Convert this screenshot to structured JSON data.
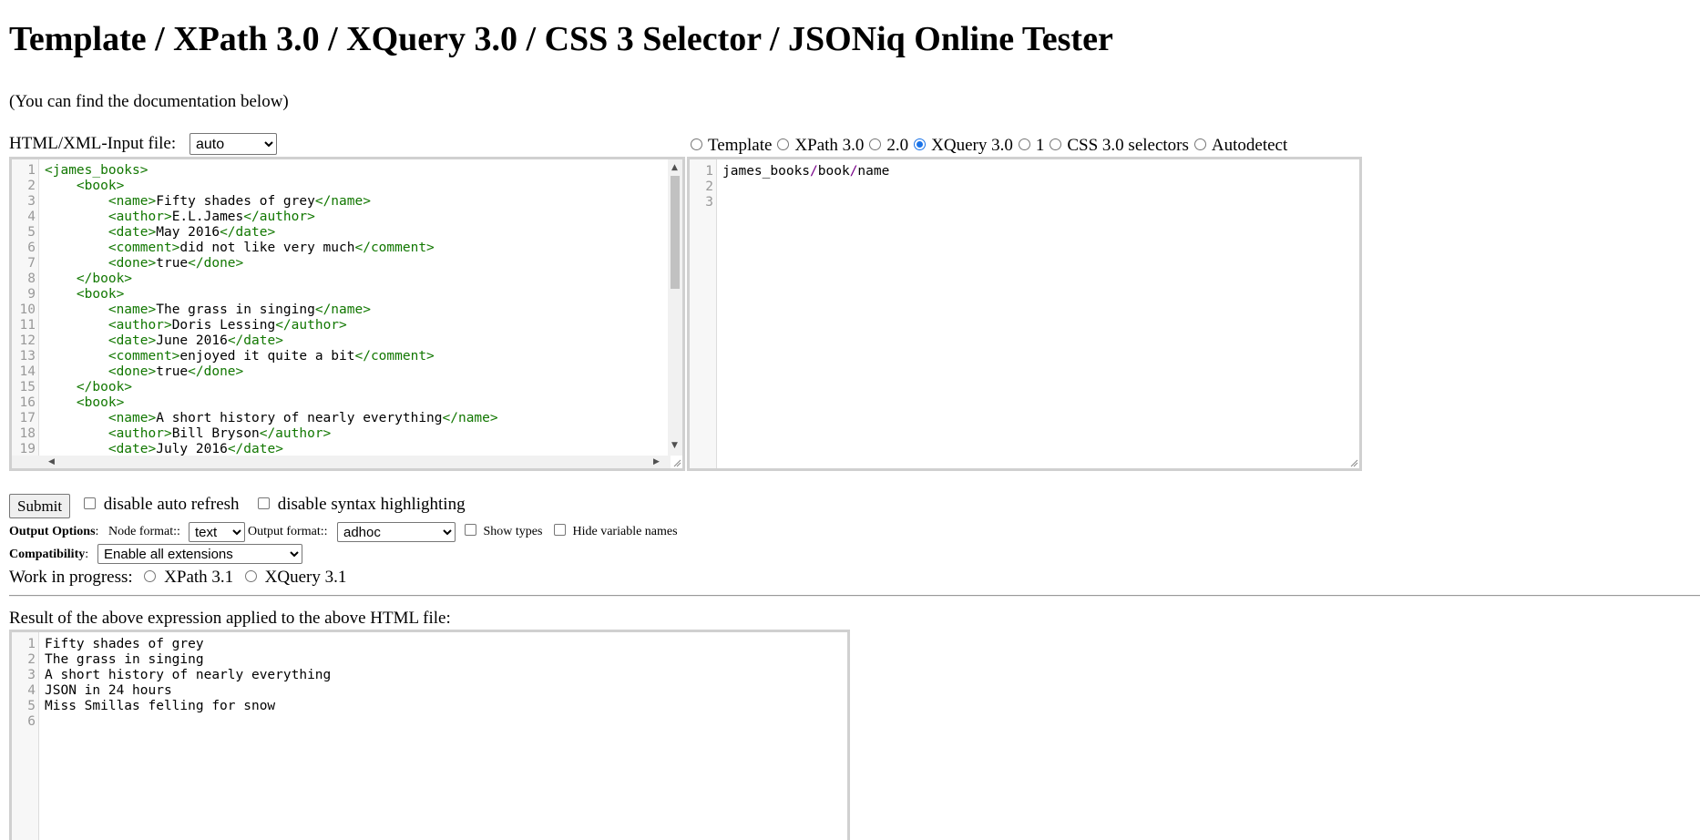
{
  "page": {
    "title": "Template / XPath 3.0 / XQuery 3.0 / CSS 3 Selector / JSONiq Online Tester",
    "doc_note": "(You can find the documentation below)"
  },
  "input": {
    "label": "HTML/XML-Input file:",
    "format_selected": "auto",
    "lines": [
      [
        [
          "t",
          "<james_books>"
        ]
      ],
      [
        [
          "p",
          "    "
        ],
        [
          "t",
          "<book>"
        ]
      ],
      [
        [
          "p",
          "        "
        ],
        [
          "t",
          "<name>"
        ],
        [
          "p",
          "Fifty shades of grey"
        ],
        [
          "t",
          "</name>"
        ]
      ],
      [
        [
          "p",
          "        "
        ],
        [
          "t",
          "<author>"
        ],
        [
          "p",
          "E.L.James"
        ],
        [
          "t",
          "</author>"
        ]
      ],
      [
        [
          "p",
          "        "
        ],
        [
          "t",
          "<date>"
        ],
        [
          "p",
          "May 2016"
        ],
        [
          "t",
          "</date>"
        ]
      ],
      [
        [
          "p",
          "        "
        ],
        [
          "t",
          "<comment>"
        ],
        [
          "p",
          "did not like very much"
        ],
        [
          "t",
          "</comment>"
        ]
      ],
      [
        [
          "p",
          "        "
        ],
        [
          "t",
          "<done>"
        ],
        [
          "p",
          "true"
        ],
        [
          "t",
          "</done>"
        ]
      ],
      [
        [
          "p",
          "    "
        ],
        [
          "t",
          "</book>"
        ]
      ],
      [
        [
          "p",
          "    "
        ],
        [
          "t",
          "<book>"
        ]
      ],
      [
        [
          "p",
          "        "
        ],
        [
          "t",
          "<name>"
        ],
        [
          "p",
          "The grass in singing"
        ],
        [
          "t",
          "</name>"
        ]
      ],
      [
        [
          "p",
          "        "
        ],
        [
          "t",
          "<author>"
        ],
        [
          "p",
          "Doris Lessing"
        ],
        [
          "t",
          "</author>"
        ]
      ],
      [
        [
          "p",
          "        "
        ],
        [
          "t",
          "<date>"
        ],
        [
          "p",
          "June 2016"
        ],
        [
          "t",
          "</date>"
        ]
      ],
      [
        [
          "p",
          "        "
        ],
        [
          "t",
          "<comment>"
        ],
        [
          "p",
          "enjoyed it quite a bit"
        ],
        [
          "t",
          "</comment>"
        ]
      ],
      [
        [
          "p",
          "        "
        ],
        [
          "t",
          "<done>"
        ],
        [
          "p",
          "true"
        ],
        [
          "t",
          "</done>"
        ]
      ],
      [
        [
          "p",
          "    "
        ],
        [
          "t",
          "</book>"
        ]
      ],
      [
        [
          "p",
          "    "
        ],
        [
          "t",
          "<book>"
        ]
      ],
      [
        [
          "p",
          "        "
        ],
        [
          "t",
          "<name>"
        ],
        [
          "p",
          "A short history of nearly everything"
        ],
        [
          "t",
          "</name>"
        ]
      ],
      [
        [
          "p",
          "        "
        ],
        [
          "t",
          "<author>"
        ],
        [
          "p",
          "Bill Bryson"
        ],
        [
          "t",
          "</author>"
        ]
      ],
      [
        [
          "p",
          "        "
        ],
        [
          "t",
          "<date>"
        ],
        [
          "p",
          "July 2016"
        ],
        [
          "t",
          "</date>"
        ]
      ],
      [
        [
          "p",
          ""
        ]
      ]
    ]
  },
  "query_modes": {
    "options": [
      {
        "label": "Template",
        "checked": false
      },
      {
        "label": "XPath 3.0",
        "checked": false
      },
      {
        "label": "2.0",
        "checked": false
      },
      {
        "label": "XQuery 3.0",
        "checked": true
      },
      {
        "label": "1",
        "checked": false
      },
      {
        "label": "CSS 3.0 selectors",
        "checked": false
      },
      {
        "label": "Autodetect",
        "checked": false
      }
    ]
  },
  "query": {
    "lines": [
      [
        [
          "p",
          "james_books"
        ],
        [
          "o",
          "/"
        ],
        [
          "p",
          "book"
        ],
        [
          "o",
          "/"
        ],
        [
          "p",
          "name"
        ]
      ],
      [
        [
          "p",
          ""
        ]
      ],
      [
        [
          "p",
          ""
        ]
      ]
    ]
  },
  "controls": {
    "submit_label": "Submit",
    "disable_auto_refresh": "disable auto refresh",
    "disable_syntax_highlighting": "disable syntax highlighting"
  },
  "output_options": {
    "label": "Output Options",
    "colon": ":",
    "node_format_label": "Node format::",
    "node_format_value": "text",
    "output_format_label": "Output format::",
    "output_format_value": "adhoc",
    "show_types": "Show types",
    "hide_variable_names": "Hide variable names"
  },
  "compatibility": {
    "label": "Compatibility",
    "colon": ":",
    "value": "Enable all extensions"
  },
  "work_in_progress": {
    "label": "Work in progress:",
    "options": [
      "XPath 3.1",
      "XQuery 3.1"
    ]
  },
  "result": {
    "label": "Result of the above expression applied to the above HTML file:",
    "lines": [
      "Fifty shades of grey",
      "The grass in singing",
      "A short history of nearly everything",
      "JSON in 24 hours",
      "Miss Smillas felling for snow",
      ""
    ]
  },
  "colors": {
    "tag": "#117700",
    "operator": "#770088",
    "radio_checked": "#1a73e8"
  }
}
